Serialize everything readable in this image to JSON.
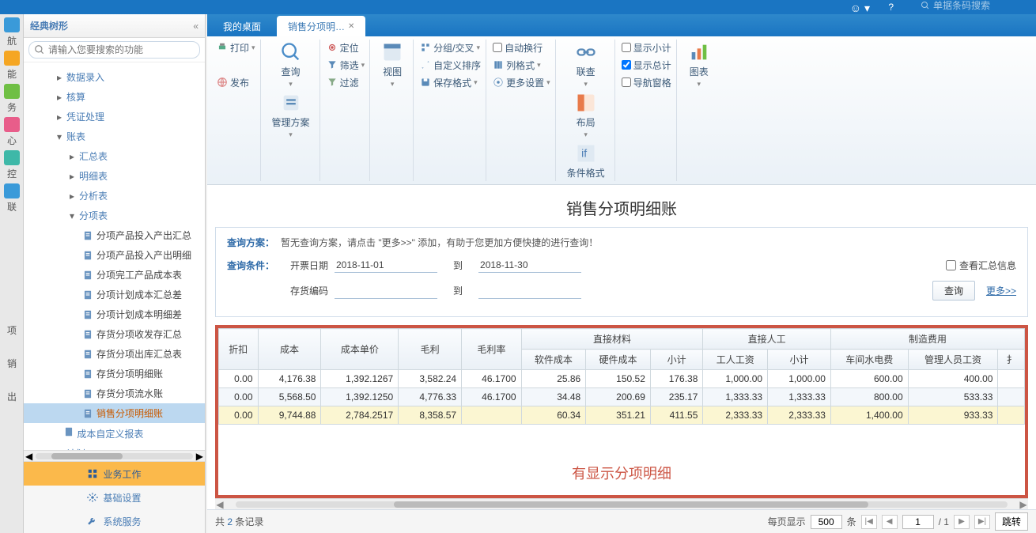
{
  "topbar": {
    "search_placeholder": "单据条码搜索"
  },
  "tree": {
    "title": "经典树形",
    "search_placeholder": "请输入您要搜索的功能",
    "items": {
      "n0": "数据录入",
      "n1": "核算",
      "n2": "凭证处理",
      "n3": "账表",
      "n3a": "汇总表",
      "n3b": "明细表",
      "n3c": "分析表",
      "n3d": "分项表",
      "leaf0": "分项产品投入产出汇总",
      "leaf1": "分项产品投入产出明细",
      "leaf2": "分项完工产品成本表",
      "leaf3": "分项计划成本汇总差",
      "leaf4": "分项计划成本明细差",
      "leaf5": "存货分项收发存汇总",
      "leaf6": "存货分项出库汇总表",
      "leaf7": "存货分项明细账",
      "leaf8": "存货分项流水账",
      "leaf9": "销售分项明细账",
      "n4": "成本自定义报表",
      "n5": "计划"
    },
    "footer": {
      "f0": "业务工作",
      "f1": "基础设置",
      "f2": "系统服务"
    }
  },
  "left_icons": {
    "i0": "航",
    "i1": "能",
    "i2": "务",
    "i3": "心",
    "i4": "控",
    "i5": "联",
    "i6": "项",
    "i7": "销",
    "i8": "出"
  },
  "tabs": {
    "t0": "我的桌面",
    "t1": "销售分项明…"
  },
  "ribbon": {
    "print": "打印",
    "publish": "发布",
    "query": "查询",
    "plan": "管理方案",
    "locate": "定位",
    "filter_sel": "筛选",
    "filter": "过滤",
    "view": "视图",
    "pivot": "分组/交叉",
    "custom_sort": "自定义排序",
    "save_fmt": "保存格式",
    "autowrap": "自动换行",
    "col_fmt": "列格式",
    "more_set": "更多设置",
    "drill": "联查",
    "layout": "布局",
    "cond_fmt": "条件格式",
    "show_sub": "显示小计",
    "show_tot": "显示总计",
    "nav_win": "导航窗格",
    "chart": "图表"
  },
  "page": {
    "title": "销售分项明细账",
    "q_plan_lbl": "查询方案：",
    "q_plan_text": "暂无查询方案，请点击 \"更多>>\" 添加，有助于您更加方便快捷的进行查询！",
    "q_cond_lbl": "查询条件：",
    "f_date_lbl": "开票日期",
    "f_date_from": "2018-11-01",
    "f_to": "到",
    "f_date_to": "2018-11-30",
    "f_stock_lbl": "存货编码",
    "chk_summary": "查看汇总信息",
    "btn_query": "查询",
    "more": "更多>>"
  },
  "table": {
    "h_discount": "折扣",
    "h_cost": "成本",
    "h_unit_cost": "成本单价",
    "h_profit": "毛利",
    "h_margin": "毛利率",
    "h_mat": "直接材料",
    "h_mat_sw": "软件成本",
    "h_mat_hw": "硬件成本",
    "h_mat_sub": "小计",
    "h_lab": "直接人工",
    "h_lab_w": "工人工资",
    "h_lab_sub": "小计",
    "h_mfg": "制造费用",
    "h_mfg_pw": "车间水电费",
    "h_mfg_mg": "管理人员工资",
    "rows": [
      {
        "discount": "0.00",
        "cost": "4,176.38",
        "unit": "1,392.1267",
        "profit": "3,582.24",
        "margin": "46.1700",
        "sw": "25.86",
        "hw": "150.52",
        "matsub": "176.38",
        "labw": "1,000.00",
        "labsub": "1,000.00",
        "pw": "600.00",
        "mg": "400.00"
      },
      {
        "discount": "0.00",
        "cost": "5,568.50",
        "unit": "1,392.1250",
        "profit": "4,776.33",
        "margin": "46.1700",
        "sw": "34.48",
        "hw": "200.69",
        "matsub": "235.17",
        "labw": "1,333.33",
        "labsub": "1,333.33",
        "pw": "800.00",
        "mg": "533.33"
      },
      {
        "discount": "0.00",
        "cost": "9,744.88",
        "unit": "2,784.2517",
        "profit": "8,358.57",
        "margin": "",
        "sw": "60.34",
        "hw": "351.21",
        "matsub": "411.55",
        "labw": "2,333.33",
        "labsub": "2,333.33",
        "pw": "1,400.00",
        "mg": "933.33"
      }
    ],
    "note": "有显示分项明细"
  },
  "pager": {
    "total_pre": "共 ",
    "total_n": "2",
    "total_suf": " 条记录",
    "perpage_lbl": "每页显示",
    "perpage_val": "500",
    "perpage_unit": "条",
    "page_cur": "1",
    "page_total": "/ 1",
    "jump": "跳转"
  }
}
